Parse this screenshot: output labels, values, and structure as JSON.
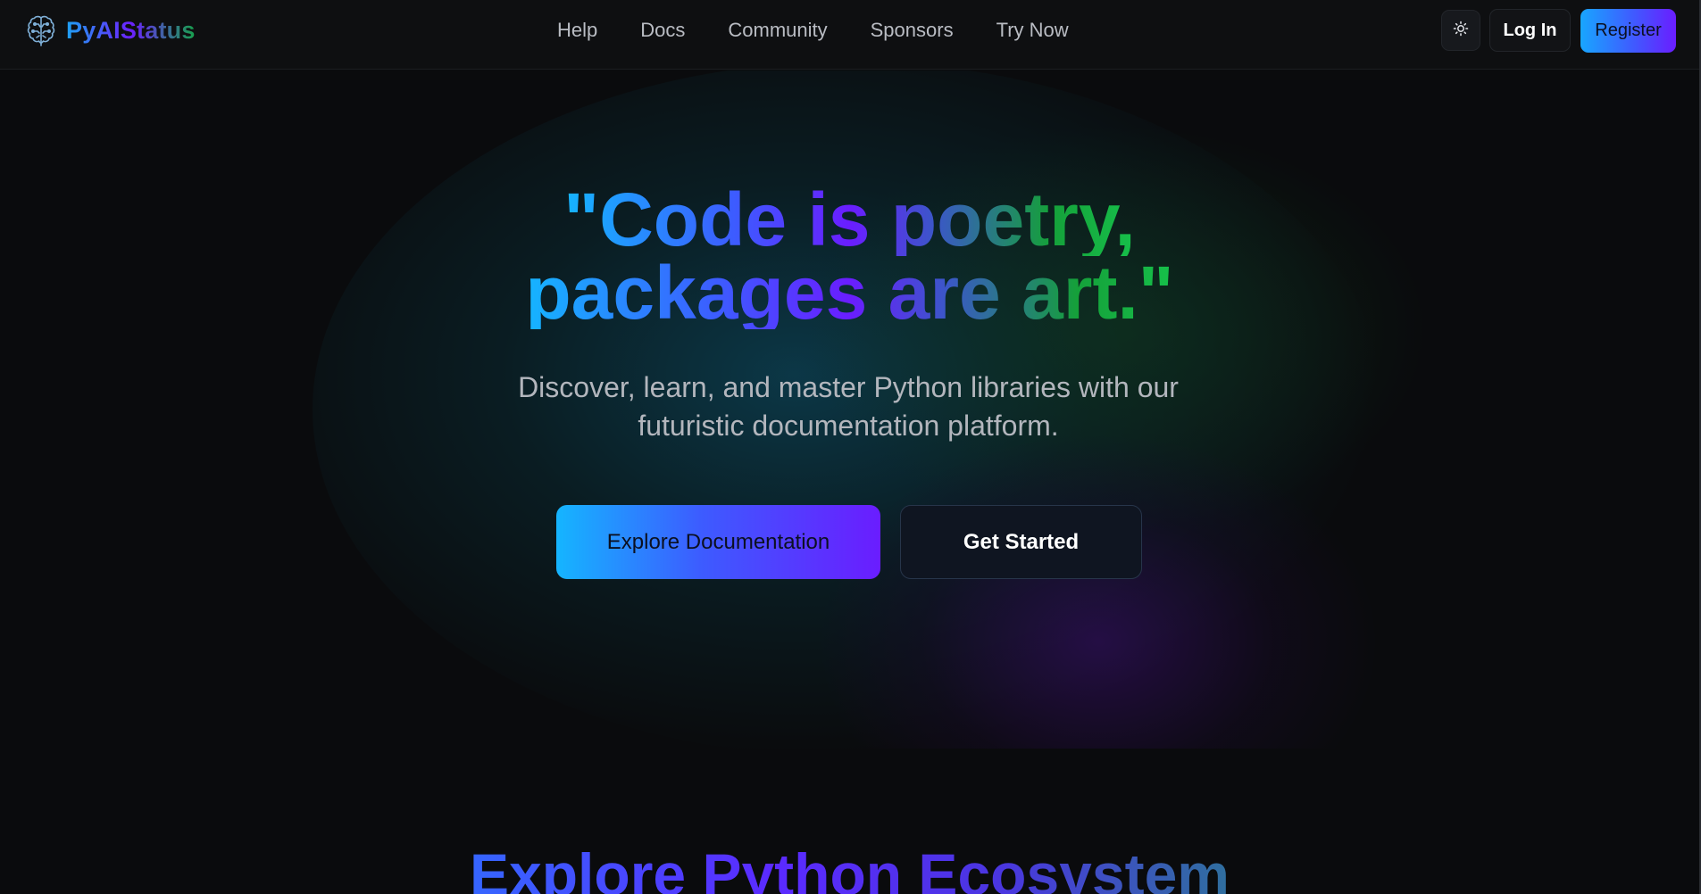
{
  "header": {
    "brand_name": "PyAIStatus",
    "brand_icon": "brain-circuit-icon",
    "nav": [
      {
        "label": "Help"
      },
      {
        "label": "Docs"
      },
      {
        "label": "Community"
      },
      {
        "label": "Sponsors"
      },
      {
        "label": "Try Now"
      }
    ],
    "theme_icon": "sun-icon",
    "login_label": "Log In",
    "register_label": "Register"
  },
  "hero": {
    "headline_line1": "\"Code is poetry,",
    "headline_line2": "packages are art.\"",
    "subtitle": "Discover, learn, and master Python libraries with our futuristic documentation platform.",
    "primary_cta": "Explore Documentation",
    "secondary_cta": "Get Started"
  },
  "section": {
    "title": "Explore Python Ecosystem"
  },
  "colors": {
    "background": "#0a0b0d",
    "accent_blue": "#15b5ff",
    "accent_purple": "#6a1dff",
    "accent_green": "#16c04a"
  }
}
